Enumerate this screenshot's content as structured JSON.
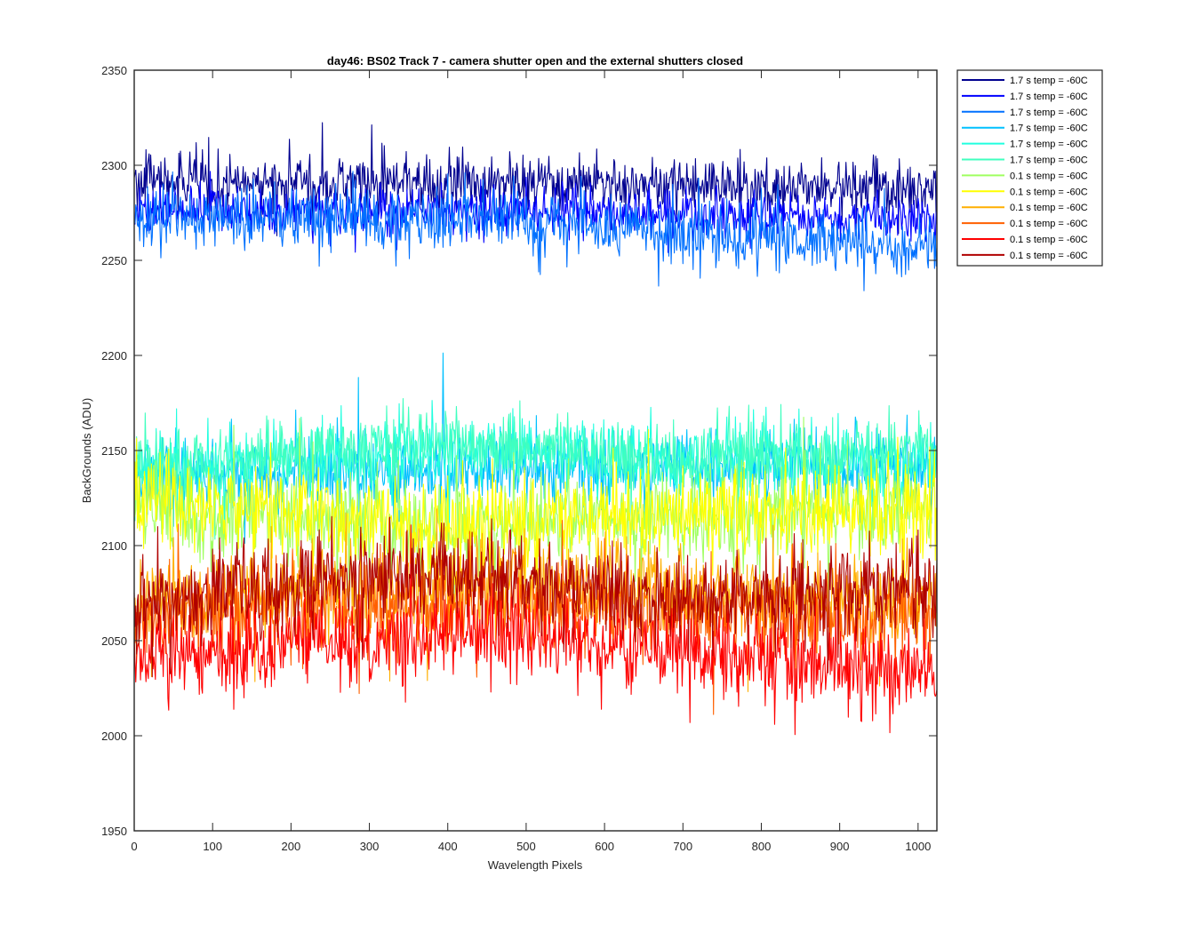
{
  "chart_data": {
    "type": "line",
    "title": "day46: BS02  Track 7 - camera shutter open and the external shutters closed",
    "xlabel": "Wavelength Pixels",
    "ylabel": "BackGrounds (ADU)",
    "xlim": [
      0,
      1024
    ],
    "ylim": [
      1950,
      2350
    ],
    "x_ticks": [
      "0",
      "100",
      "200",
      "300",
      "400",
      "500",
      "600",
      "700",
      "800",
      "900",
      "1000"
    ],
    "y_ticks": [
      "1950",
      "2000",
      "2050",
      "2100",
      "2150",
      "2200",
      "2250",
      "2300",
      "2350"
    ],
    "x_tick_values": [
      0,
      100,
      200,
      300,
      400,
      500,
      600,
      700,
      800,
      900,
      1000
    ],
    "y_tick_values": [
      1950,
      2000,
      2050,
      2100,
      2150,
      2200,
      2250,
      2300,
      2350
    ],
    "grid": false,
    "legend_position": "outside-top-right",
    "series": [
      {
        "name": "1.7 s temp = -60C",
        "color": "#00008f",
        "mean": 2291,
        "noise": 7,
        "spikes": 14,
        "trend": [
          [
            0,
            2292
          ],
          [
            500,
            2290
          ],
          [
            1024,
            2288
          ]
        ]
      },
      {
        "name": "1.7 s temp = -60C",
        "color": "#0000ff",
        "mean": 2275,
        "noise": 6,
        "spikes": 10,
        "trend": [
          [
            0,
            2276
          ],
          [
            500,
            2276
          ],
          [
            1024,
            2271
          ]
        ]
      },
      {
        "name": "1.7 s temp = -60C",
        "color": "#0070ff",
        "mean": 2270,
        "noise": 8,
        "spikes": 16,
        "trend": [
          [
            0,
            2272
          ],
          [
            500,
            2271
          ],
          [
            800,
            2262
          ],
          [
            1024,
            2256
          ]
        ]
      },
      {
        "name": "1.7 s temp = -60C",
        "color": "#00c0ff",
        "mean": 2138,
        "noise": 9,
        "spikes": 18,
        "trend": [
          [
            0,
            2135
          ],
          [
            500,
            2140
          ],
          [
            1024,
            2142
          ]
        ]
      },
      {
        "name": "1.7 s temp = -60C",
        "color": "#20ffdf",
        "mean": 2142,
        "noise": 9,
        "spikes": 18,
        "trend": [
          [
            0,
            2140
          ],
          [
            450,
            2150
          ],
          [
            700,
            2143
          ],
          [
            1024,
            2145
          ]
        ]
      },
      {
        "name": "1.7 s temp = -60C",
        "color": "#40ffbf",
        "mean": 2150,
        "noise": 9,
        "spikes": 18,
        "trend": [
          [
            0,
            2140
          ],
          [
            450,
            2155
          ],
          [
            700,
            2145
          ],
          [
            1024,
            2150
          ]
        ]
      },
      {
        "name": "0.1 s temp = -60C",
        "color": "#9fff60",
        "mean": 2115,
        "noise": 12,
        "spikes": 22,
        "trend": [
          [
            0,
            2120
          ],
          [
            400,
            2110
          ],
          [
            1024,
            2120
          ]
        ]
      },
      {
        "name": "0.1 s temp = -60C",
        "color": "#ffff00",
        "mean": 2118,
        "noise": 12,
        "spikes": 22,
        "trend": [
          [
            0,
            2125
          ],
          [
            400,
            2110
          ],
          [
            800,
            2120
          ],
          [
            1024,
            2120
          ]
        ]
      },
      {
        "name": "0.1 s temp = -60C",
        "color": "#ffaf00",
        "mean": 2075,
        "noise": 12,
        "spikes": 22,
        "trend": [
          [
            0,
            2070
          ],
          [
            450,
            2080
          ],
          [
            1024,
            2072
          ]
        ]
      },
      {
        "name": "0.1 s temp = -60C",
        "color": "#ff6000",
        "mean": 2065,
        "noise": 12,
        "spikes": 22,
        "trend": [
          [
            0,
            2062
          ],
          [
            450,
            2070
          ],
          [
            1024,
            2062
          ]
        ]
      },
      {
        "name": "0.1 s temp = -60C",
        "color": "#ff0000",
        "mean": 2045,
        "noise": 11,
        "spikes": 22,
        "trend": [
          [
            0,
            2040
          ],
          [
            450,
            2055
          ],
          [
            1024,
            2032
          ]
        ]
      },
      {
        "name": "0.1 s temp = -60C",
        "color": "#b00000",
        "mean": 2078,
        "noise": 12,
        "spikes": 22,
        "trend": [
          [
            0,
            2068
          ],
          [
            350,
            2088
          ],
          [
            700,
            2070
          ],
          [
            1024,
            2078
          ]
        ]
      }
    ]
  }
}
